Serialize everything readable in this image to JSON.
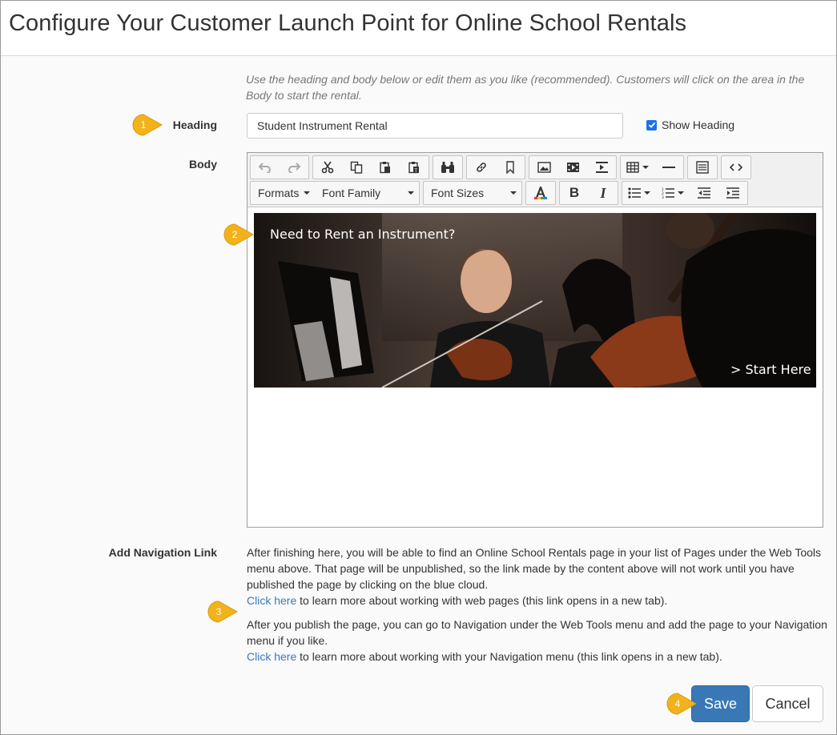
{
  "page": {
    "title": "Configure Your Customer Launch Point for Online School Rentals",
    "intro": "Use the heading and body below or edit them as you like (recommended). Customers will click on the area in the Body to start the rental."
  },
  "form": {
    "heading_label": "Heading",
    "heading_value": "Student Instrument Rental",
    "show_heading_label": "Show Heading",
    "show_heading_checked": true,
    "body_label": "Body",
    "nav_label": "Add Navigation Link"
  },
  "toolbar": {
    "formats": "Formats",
    "font_family": "Font Family",
    "font_sizes": "Font Sizes"
  },
  "banner": {
    "headline": "Need to Rent an Instrument?",
    "cta": "> Start Here"
  },
  "nav": {
    "para1": "After finishing here, you will be able to find an Online School Rentals page in your list of Pages under the Web Tools menu above. That page will be unpublished, so the link made by the content above will not work until you have published the page by clicking on the blue cloud.",
    "link1": "Click here",
    "link1_rest": " to learn more about working with web pages (this link opens in a new tab).",
    "para2": "After you publish the page, you can go to Navigation under the Web Tools menu and add the page to your Navigation menu if you like.",
    "link2": "Click here",
    "link2_rest": " to learn more about working with your Navigation menu (this link opens in a new tab)."
  },
  "buttons": {
    "save": "Save",
    "cancel": "Cancel"
  },
  "callouts": [
    "1",
    "2",
    "3",
    "4"
  ],
  "colors": {
    "accent": "#3a78b5",
    "link": "#3a7ab8",
    "callout": "#f2b21c"
  }
}
